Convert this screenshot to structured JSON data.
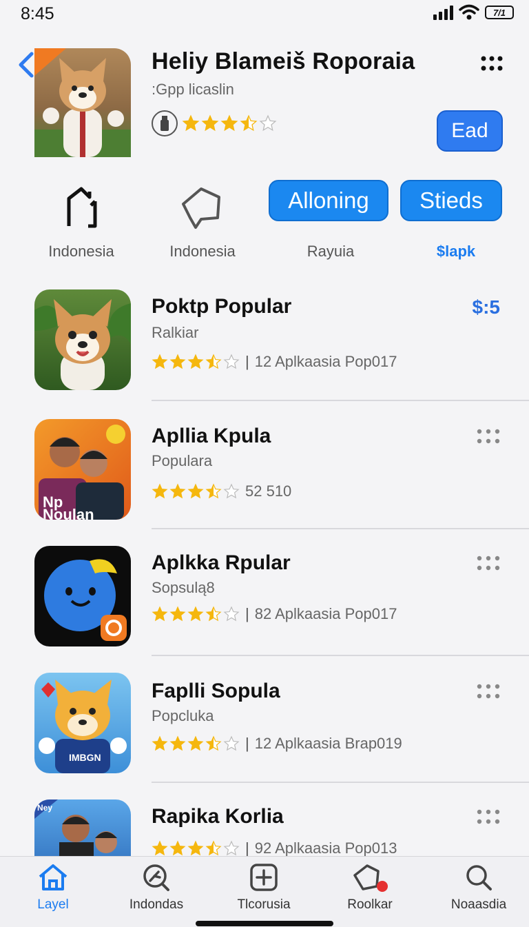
{
  "status_bar": {
    "time": "8:45",
    "battery_label": "7/1"
  },
  "header": {
    "title": "Heliy Blameiš Roporaia",
    "subtitle": ":Gpp licaslin",
    "rating": 3.5,
    "get_button": "Ead",
    "hero_icon_badge": "Boleil"
  },
  "segments": {
    "items": [
      {
        "label": "Indonesia",
        "icon": "house-outline-icon"
      },
      {
        "label": "Indonesia",
        "icon": "tag-icon"
      },
      {
        "label": "Rayuia",
        "pill": "Alloning"
      },
      {
        "label": "$lapk",
        "pill": "Stieds"
      }
    ]
  },
  "apps": [
    {
      "title": "Poktp Popular",
      "subtitle": "Ralkiar",
      "rating": 3.5,
      "meta": "12  Aplkaasia Pop017",
      "price": "$:5"
    },
    {
      "title": "Apllia Kpula",
      "subtitle": "Populara",
      "rating": 3.5,
      "meta": "52  510",
      "icon_text": "Np\nNoulan"
    },
    {
      "title": "Aplkka Rpular",
      "subtitle": "Sopsulą8",
      "rating": 3.5,
      "meta": "82  Aplkaasia Pop017"
    },
    {
      "title": "Faplli Sopula",
      "subtitle": "Popcluka",
      "rating": 3.5,
      "meta": "12  Aplkaasia Brap019",
      "icon_text": "IMBGN"
    },
    {
      "title": "Rapika Korlia",
      "subtitle": "",
      "rating": 3.5,
      "meta": "92  Aplkaasia Pop013",
      "icon_text": "Ney"
    }
  ],
  "tab_bar": {
    "tabs": [
      {
        "label": "Layel",
        "icon": "home-icon",
        "active": true
      },
      {
        "label": "Indondas",
        "icon": "search-compass-icon"
      },
      {
        "label": "Tlcorusia",
        "icon": "plus-square-icon"
      },
      {
        "label": "Roolkar",
        "icon": "tag-icon",
        "badge": true
      },
      {
        "label": "Noaasdia",
        "icon": "search-icon"
      }
    ]
  },
  "colors": {
    "accent": "#1b88f0",
    "star": "#f5b70e",
    "price": "#2a6fe0"
  }
}
